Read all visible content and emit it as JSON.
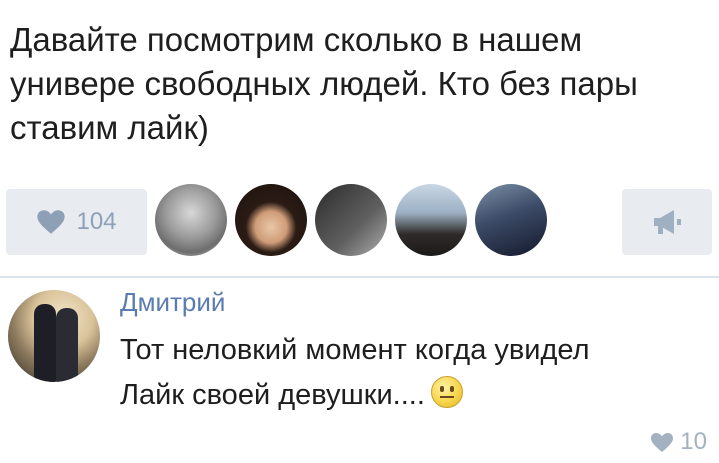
{
  "post": {
    "text": "Давайте посмотрим сколько в нашем\nунивере свободных людей. Кто без пары\nставим лайк)"
  },
  "actions": {
    "like_count": "104",
    "like_icon": "heart-icon",
    "repost_icon": "megaphone-icon",
    "accent_color": "#8da0b6"
  },
  "comment": {
    "author": "Дмитрий",
    "text": "Тот неловкий момент когда увидел\nЛайк своей девушки....",
    "emoji": "neutral-face-emoji",
    "like_count": "10"
  }
}
